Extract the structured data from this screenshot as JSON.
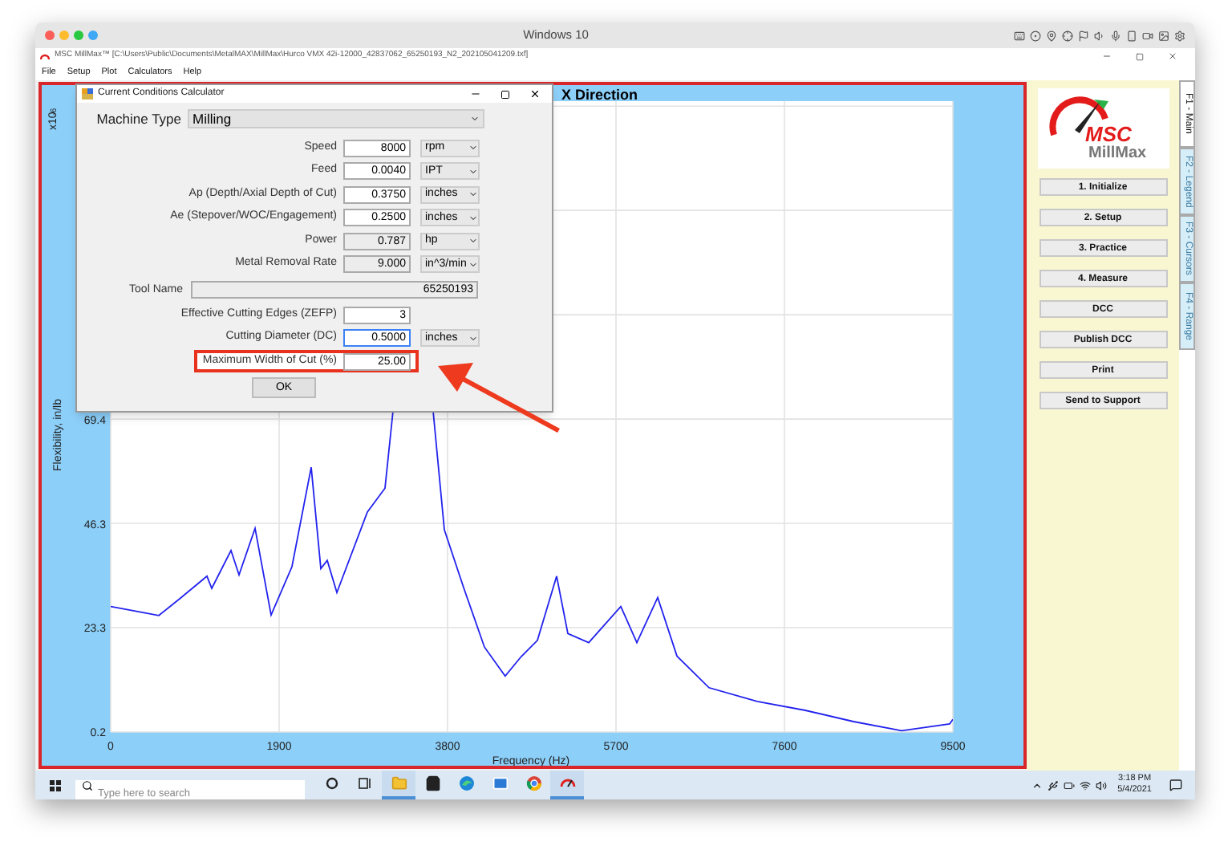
{
  "host_window": {
    "title": "Windows 10"
  },
  "app_window": {
    "title": "MSC MillMax™ [C:\\Users\\Public\\Documents\\MetalMAX\\MillMax\\Hurco  VMX 42i-12000_42837062_65250193_N2_202105041209.txf]"
  },
  "menu": [
    "File",
    "Setup",
    "Plot",
    "Calculators",
    "Help"
  ],
  "plot": {
    "title": "X Direction",
    "exponent": "x10$^{-6}$",
    "chart_data": {
      "type": "line",
      "xlabel": "Frequency (Hz)",
      "ylabel": "Flexibility, in/lb",
      "xlim": [
        0,
        9500
      ],
      "ylim": [
        0.2,
        139.9
      ],
      "xticks": [
        0,
        1900,
        3800,
        5700,
        7600,
        9500
      ],
      "yticks": [
        0.2,
        23.3,
        46.3,
        69.4
      ],
      "grid": true,
      "x": [
        0,
        543,
        778,
        1086,
        1140,
        1357,
        1448,
        1629,
        1810,
        2045,
        2262,
        2370,
        2443,
        2551,
        2895,
        3094,
        3185,
        3311,
        3529,
        3637,
        3764,
        3981,
        4216,
        4450,
        4631,
        4813,
        5030,
        5157,
        5392,
        5754,
        5935,
        6170,
        6387,
        6750,
        7293,
        7836,
        8379,
        8922,
        9464,
        9500
      ],
      "series": [
        {
          "color": "#2222ee",
          "values": [
            28,
            26,
            29.7,
            34.7,
            32,
            40.4,
            35,
            45.3,
            26.1,
            36.8,
            58.8,
            36.4,
            38.2,
            31.1,
            48.9,
            54.2,
            71.3,
            null,
            null,
            71.3,
            45,
            32.2,
            19,
            12.6,
            16.9,
            20.5,
            34.7,
            22,
            20,
            28,
            20,
            30,
            17,
            10,
            7,
            5,
            2.5,
            0.5,
            2,
            3
          ]
        }
      ]
    }
  },
  "dialog": {
    "title": "Current Conditions Calculator",
    "machine_type": {
      "label": "Machine Type",
      "value": "Milling"
    },
    "rows": [
      {
        "kind": "field",
        "label": "Speed",
        "value": "8000",
        "unit": "rpm",
        "readonly": false,
        "focused": false,
        "highlighted": false
      },
      {
        "kind": "field",
        "label": "Feed",
        "value": "0.0040",
        "unit": "IPT",
        "readonly": false,
        "focused": false,
        "highlighted": false
      },
      {
        "kind": "field",
        "label": "Ap (Depth/Axial Depth of Cut)",
        "value": "0.3750",
        "unit": "inches",
        "readonly": false,
        "focused": false,
        "highlighted": false
      },
      {
        "kind": "field",
        "label": "Ae (Stepover/WOC/Engagement)",
        "value": "0.2500",
        "unit": "inches",
        "readonly": false,
        "focused": false,
        "highlighted": false
      },
      {
        "kind": "field",
        "label": "Power",
        "value": "0.787",
        "unit": "hp",
        "readonly": true,
        "focused": false,
        "highlighted": false
      },
      {
        "kind": "field",
        "label": "Metal Removal Rate",
        "value": "9.000",
        "unit": "in^3/min",
        "readonly": true,
        "focused": false,
        "highlighted": false
      },
      {
        "kind": "wide",
        "label": "Tool Name",
        "value": "65250193",
        "readonly": true,
        "focused": false,
        "highlighted": false
      },
      {
        "kind": "field",
        "label": "Effective Cutting Edges (ZEFP)",
        "value": "3",
        "readonly": false,
        "focused": false,
        "highlighted": false
      },
      {
        "kind": "field",
        "label": "Cutting Diameter (DC)",
        "value": "0.5000",
        "unit": "inches",
        "readonly": false,
        "focused": true,
        "highlighted": false
      },
      {
        "kind": "field",
        "label": "Maximum Width of Cut (%)",
        "value": "25.00",
        "readonly": false,
        "focused": false,
        "highlighted": true
      }
    ],
    "ok": "OK"
  },
  "sidebar": {
    "logo": {
      "brand": "MSC",
      "product": "MillMax"
    },
    "buttons": [
      "1. Initialize",
      "2. Setup",
      "3. Practice",
      "4. Measure",
      "DCC",
      "Publish DCC",
      "Print",
      "Send to Support"
    ],
    "tabs": [
      {
        "label": "F1 - Main",
        "selected": true
      },
      {
        "label": "F2 - Legend",
        "selected": false
      },
      {
        "label": "F3 - Cursors",
        "selected": false
      },
      {
        "label": "F4 - Range",
        "selected": false
      }
    ]
  },
  "taskbar": {
    "search": {
      "placeholder": "Type here to search"
    },
    "apps": [
      {
        "kind": "cortana",
        "open": false
      },
      {
        "kind": "taskview",
        "open": false
      },
      {
        "kind": "folder",
        "open": true
      },
      {
        "kind": "store",
        "open": false
      },
      {
        "kind": "edge",
        "open": false
      },
      {
        "kind": "mail",
        "open": false
      },
      {
        "kind": "chrome",
        "open": false
      },
      {
        "kind": "millmax",
        "open": true
      }
    ],
    "time": "3:18 PM",
    "date": "5/4/2021"
  }
}
